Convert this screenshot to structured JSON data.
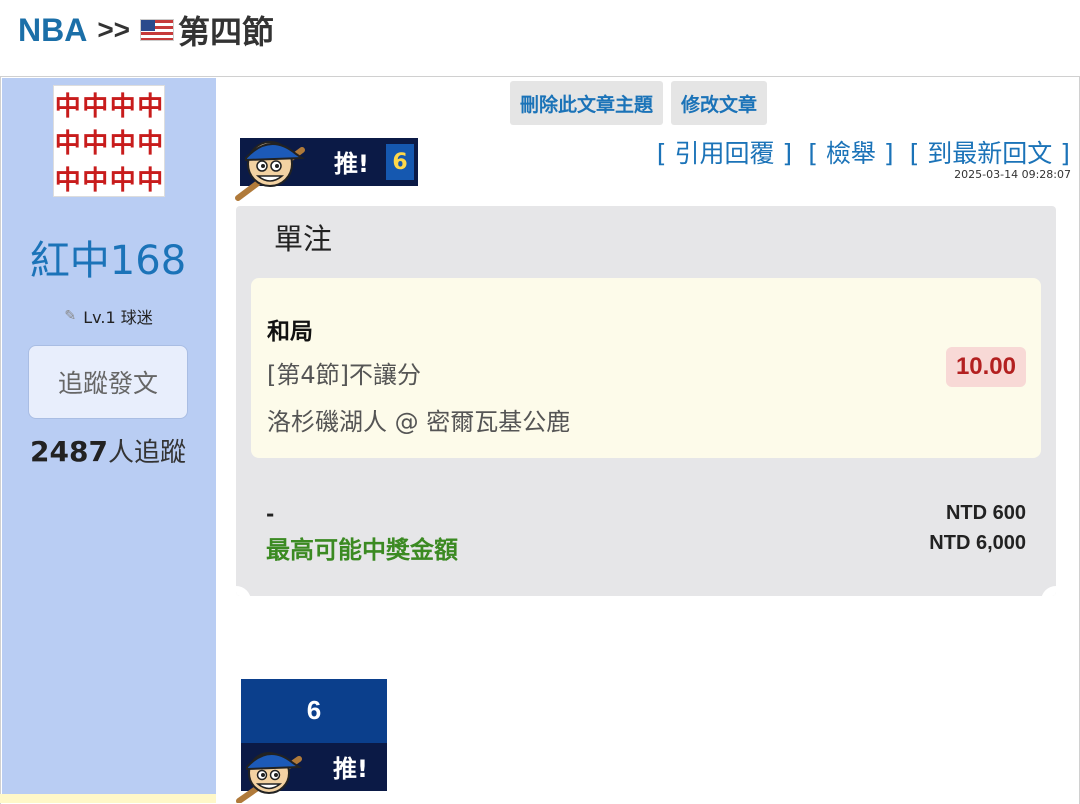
{
  "breadcrumb": {
    "section": "NBA",
    "separator": ">>",
    "title": "第四節"
  },
  "sidebar": {
    "avatar_glyph": "中",
    "username": "紅中168",
    "level": "Lv.1 球迷",
    "follow_button": "追蹤發文",
    "follower_count": "2487",
    "follower_suffix": "人追蹤"
  },
  "admin": {
    "delete_topic": "刪除此文章主題",
    "edit_post": "修改文章"
  },
  "post": {
    "push_label": "推!",
    "push_count": "6",
    "quote_reply": "[ 引用回覆 ]",
    "report": "[ 檢舉 ]",
    "latest_reply": "[ 到最新回文 ]",
    "timestamp": "2025-03-14 09:28:07"
  },
  "bet": {
    "type": "單注",
    "outcome": "和局",
    "market": "[第4節]不讓分",
    "match": "洛杉磯湖人 @ 密爾瓦基公鹿",
    "odds": "10.00",
    "dash": "-",
    "payout_label": "最高可能中獎金額",
    "stake": "NTD 600",
    "payout": "NTD 6,000"
  },
  "footer_push": {
    "count": "6",
    "label": "推!"
  },
  "colors": {
    "sidebar": "#b9cdf3",
    "link": "#1b73b8",
    "odds_text": "#b32020",
    "payout_label": "#3b8a22",
    "badge_dark": "#0b1a46",
    "badge_blue": "#0b3f8c"
  }
}
